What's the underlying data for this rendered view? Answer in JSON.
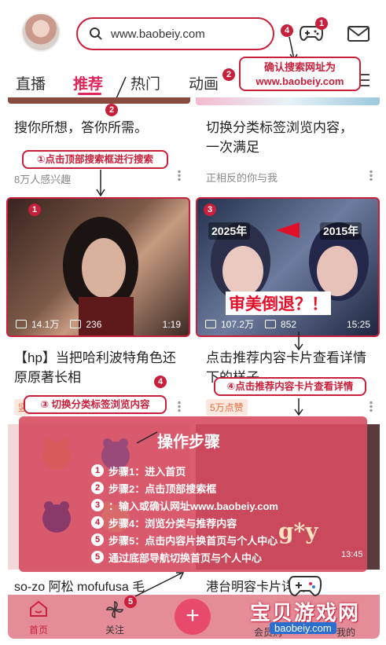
{
  "header": {
    "search_text": "www.baobeiy.com",
    "game_badge": "1",
    "search_badge": "4"
  },
  "tabs": [
    {
      "label": "直播"
    },
    {
      "label": "推荐"
    },
    {
      "label": "热门"
    },
    {
      "label": "动画"
    }
  ],
  "tab_badge": "2",
  "callout_top": "确认搜索网址为\nwww.baobeiy.com",
  "step_badge_tabs": "2",
  "feed": {
    "card1": {
      "title": "搜你所想，答你所需。",
      "meta": "8万人感兴趣"
    },
    "card2": {
      "title": "切换分类标签浏览内容，\n一次满足",
      "meta": "正相反的你与我"
    },
    "search_tip": "①点击顶部搜索框进行搜索",
    "video1": {
      "badge": "1",
      "views": "14.1万",
      "danmaku": "236",
      "duration": "1:19",
      "title": "【hp】当把哈利波特角色还原原著长相",
      "tag": "竖",
      "badge_below": "4"
    },
    "video2": {
      "badge": "3",
      "views": "107.2万",
      "danmaku": "852",
      "duration": "15:25",
      "year_left": "2025年",
      "year_right": "2015年",
      "overlay_text": "审美倒退？！",
      "title": "点击推荐内容卡片查看详情\n下的样子",
      "tag": "5万点赞"
    },
    "tip_tabs": "③ 切换分类标签浏览内容",
    "tip_card": "④点击推荐内容卡片查看详情"
  },
  "steps": {
    "title": "操作步骤",
    "items": [
      {
        "num": "1",
        "text": "步骤1：进入首页"
      },
      {
        "num": "2",
        "text": "步骤2：点击顶部搜索框"
      },
      {
        "num": "3",
        "text": "：输入或确认网址www.baobeiy.com"
      },
      {
        "num": "4",
        "text": "步骤4：浏览分类与推荐内容"
      },
      {
        "num": "5",
        "text": "步骤5：点击内容片换首页与个人中心"
      },
      {
        "num": "5",
        "text": "通过底部导航切换首页与个人中心"
      }
    ],
    "behind_text": "g*y",
    "behind_duration": "13:45"
  },
  "below_cards": {
    "left_title": "so-zo 阿松 mofufusa 毛",
    "right_title": "港台明容卡片详情"
  },
  "bottom_nav": {
    "home": "首页",
    "follow": "关注",
    "follow_badge": "5",
    "add": "+",
    "member": "会员购",
    "mine": "我的"
  },
  "watermark": {
    "name": "宝贝游戏网",
    "url": "baobeiy.com"
  },
  "colors": {
    "brand_pink": "#e0255a",
    "annotation_red": "#c81f3a",
    "panel": "#d64b60"
  }
}
